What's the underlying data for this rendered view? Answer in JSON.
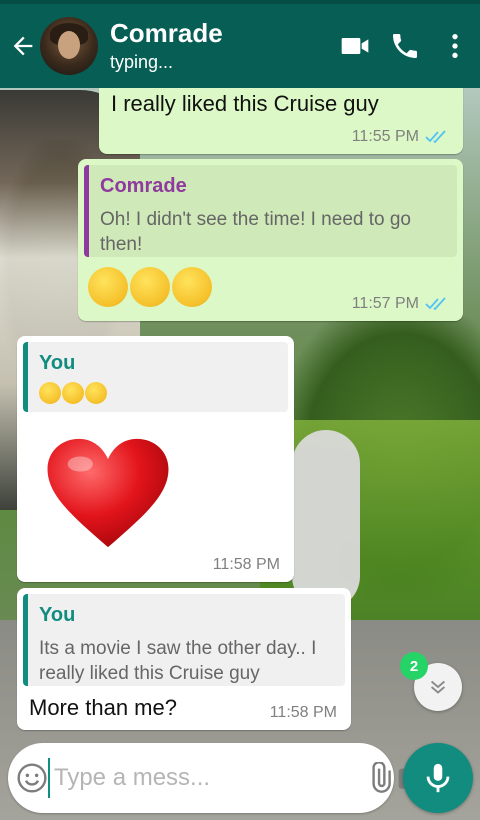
{
  "header": {
    "contact_name": "Comrade",
    "status": "typing..."
  },
  "messages": [
    {
      "id": "m1",
      "direction": "out",
      "text": "I really liked this Cruise guy",
      "time": "11:55 PM",
      "read": true
    },
    {
      "id": "m2",
      "direction": "out",
      "quote": {
        "author": "Comrade",
        "text": "Oh! I didn't see the time! I need to go then!"
      },
      "emoji": "🙂🙂🙂",
      "time": "11:57 PM",
      "read": true
    },
    {
      "id": "m3",
      "direction": "in",
      "quote": {
        "author": "You",
        "text": "🙂🙂🙂"
      },
      "emoji": "❤️",
      "time": "11:58 PM"
    },
    {
      "id": "m4",
      "direction": "in",
      "quote": {
        "author": "You",
        "text": "Its a movie I saw the other day.. I really liked this Cruise guy"
      },
      "text": "More than me?",
      "time": "11:58 PM"
    }
  ],
  "scroll_fab": {
    "unread_count": "2"
  },
  "composer": {
    "placeholder": "Type a mess..."
  },
  "colors": {
    "header": "#075e54",
    "outgoing_bubble": "#dcf8c6",
    "incoming_bubble": "#ffffff",
    "quote_comrade": "#8e3a9e",
    "quote_you": "#128c7e",
    "read_ticks": "#4fc3f7",
    "mic_button": "#128c7e",
    "badge": "#25d366"
  },
  "icons": [
    "back-arrow-icon",
    "video-call-icon",
    "phone-icon",
    "more-vert-icon",
    "emoji-icon",
    "attach-icon",
    "camera-icon",
    "mic-icon",
    "chevron-double-down-icon",
    "double-check-icon"
  ]
}
